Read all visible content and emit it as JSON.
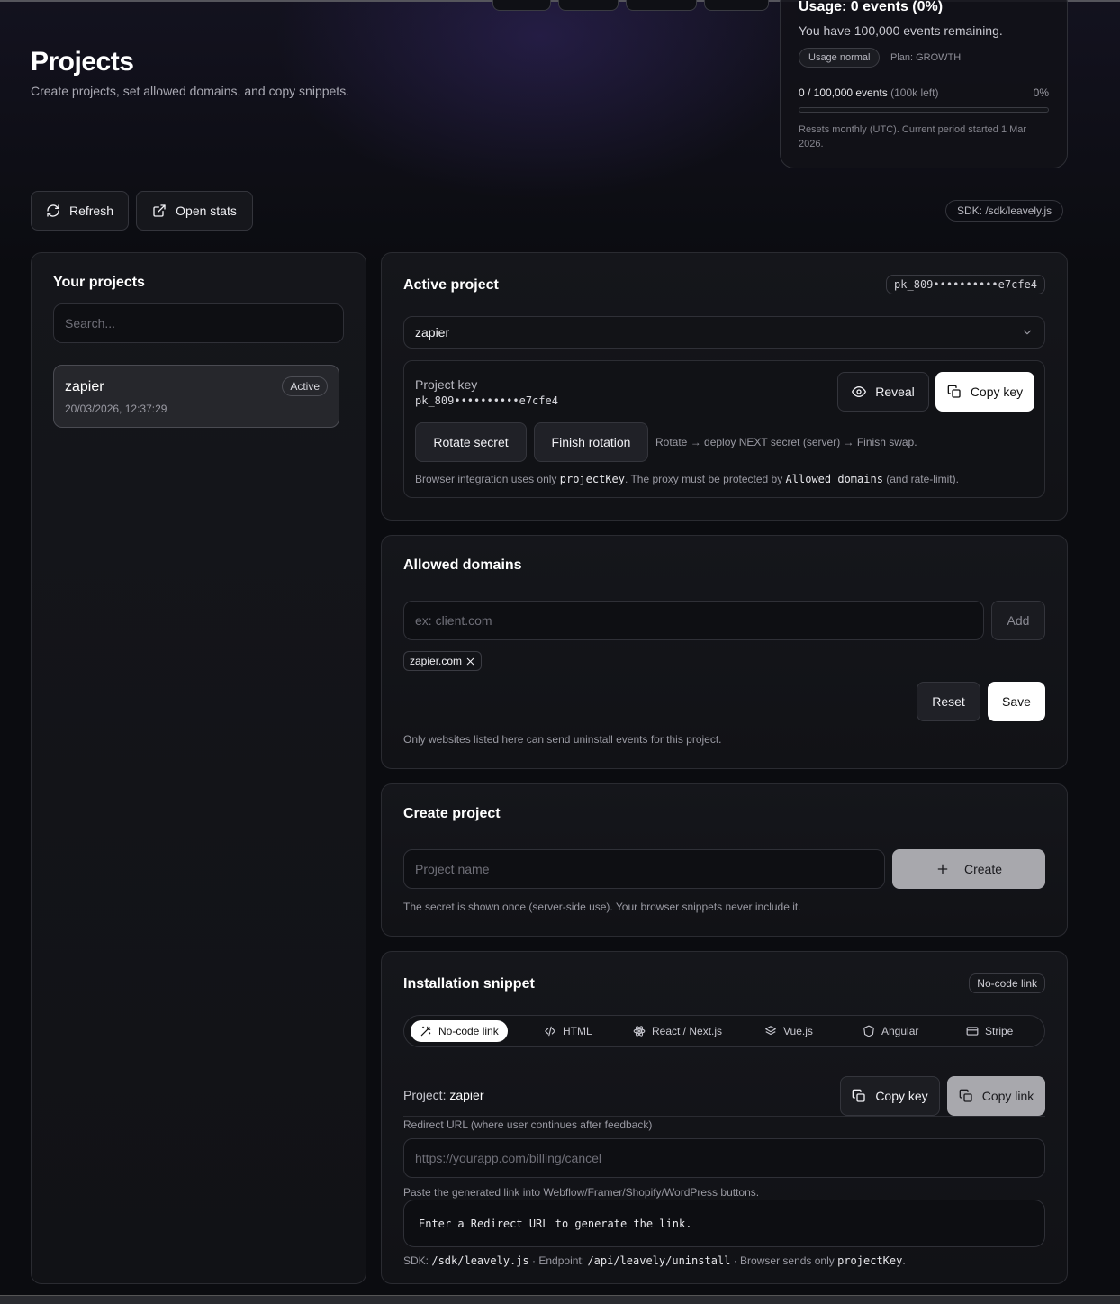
{
  "page": {
    "title": "Projects",
    "subtitle": "Create projects, set allowed domains, and copy snippets."
  },
  "usage": {
    "title": "Usage: 0 events (0%)",
    "remaining": "You have 100,000 events remaining.",
    "status_badge": "Usage normal",
    "plan": "Plan: GROWTH",
    "count": "0 / 100,000 events",
    "left": "(100k left)",
    "percent": "0%",
    "progress_fraction": 0,
    "reset_note": "Resets monthly (UTC). Current period started 1 Mar 2026."
  },
  "toolbar": {
    "refresh_label": "Refresh",
    "open_stats_label": "Open stats",
    "sdk_badge": "SDK: /sdk/leavely.js"
  },
  "projects_panel": {
    "title": "Your projects",
    "search_placeholder": "Search...",
    "items": [
      {
        "name": "zapier",
        "date": "20/03/2026, 12:37:29",
        "badge": "Active"
      }
    ]
  },
  "active_project": {
    "title": "Active project",
    "key_badge": "pk_809••••••••••e7cfe4",
    "selected": "zapier",
    "key_label": "Project key",
    "key_value": "pk_809••••••••••e7cfe4",
    "reveal_label": "Reveal",
    "copy_key_label": "Copy key",
    "rotate_label": "Rotate secret",
    "finish_label": "Finish rotation",
    "rotate_note": "Rotate → deploy NEXT secret (server) → Finish swap.",
    "integration_note_1": "Browser integration uses only ",
    "integration_code_1": "projectKey",
    "integration_note_2": ". The proxy must be protected by ",
    "integration_code_2": "Allowed domains",
    "integration_note_3": " (and rate-limit)."
  },
  "allowed_domains": {
    "title": "Allowed domains",
    "placeholder": "ex: client.com",
    "add_label": "Add",
    "tags": [
      "zapier.com"
    ],
    "reset_label": "Reset",
    "save_label": "Save",
    "note": "Only websites listed here can send uninstall events for this project."
  },
  "create_project": {
    "title": "Create project",
    "placeholder": "Project name",
    "create_label": "Create",
    "note": "The secret is shown once (server-side use). Your browser snippets never include it."
  },
  "snippet": {
    "title": "Installation snippet",
    "badge": "No-code link",
    "tabs": [
      {
        "label": "No-code link",
        "icon": "wand-icon"
      },
      {
        "label": "HTML",
        "icon": "code-icon"
      },
      {
        "label": "React / Next.js",
        "icon": "atom-icon"
      },
      {
        "label": "Vue.js",
        "icon": "layers-icon"
      },
      {
        "label": "Angular",
        "icon": "shield-icon"
      },
      {
        "label": "Stripe",
        "icon": "card-icon"
      }
    ],
    "project_prefix": "Project: ",
    "project_name": "zapier",
    "copy_key_label": "Copy key",
    "copy_link_label": "Copy link",
    "redirect_label": "Redirect URL (where user continues after feedback)",
    "redirect_placeholder": "https://yourapp.com/billing/cancel",
    "paste_note": "Paste the generated link into Webflow/Framer/Shopify/WordPress buttons.",
    "code_text": "Enter a Redirect URL to generate the link.",
    "footer_sdk_label": "SDK: ",
    "footer_sdk": "/sdk/leavely.js",
    "footer_endpoint_label": " · Endpoint: ",
    "footer_endpoint": "/api/leavely/uninstall",
    "footer_sends": " · Browser sends only ",
    "footer_key": "projectKey",
    "footer_end": "."
  }
}
